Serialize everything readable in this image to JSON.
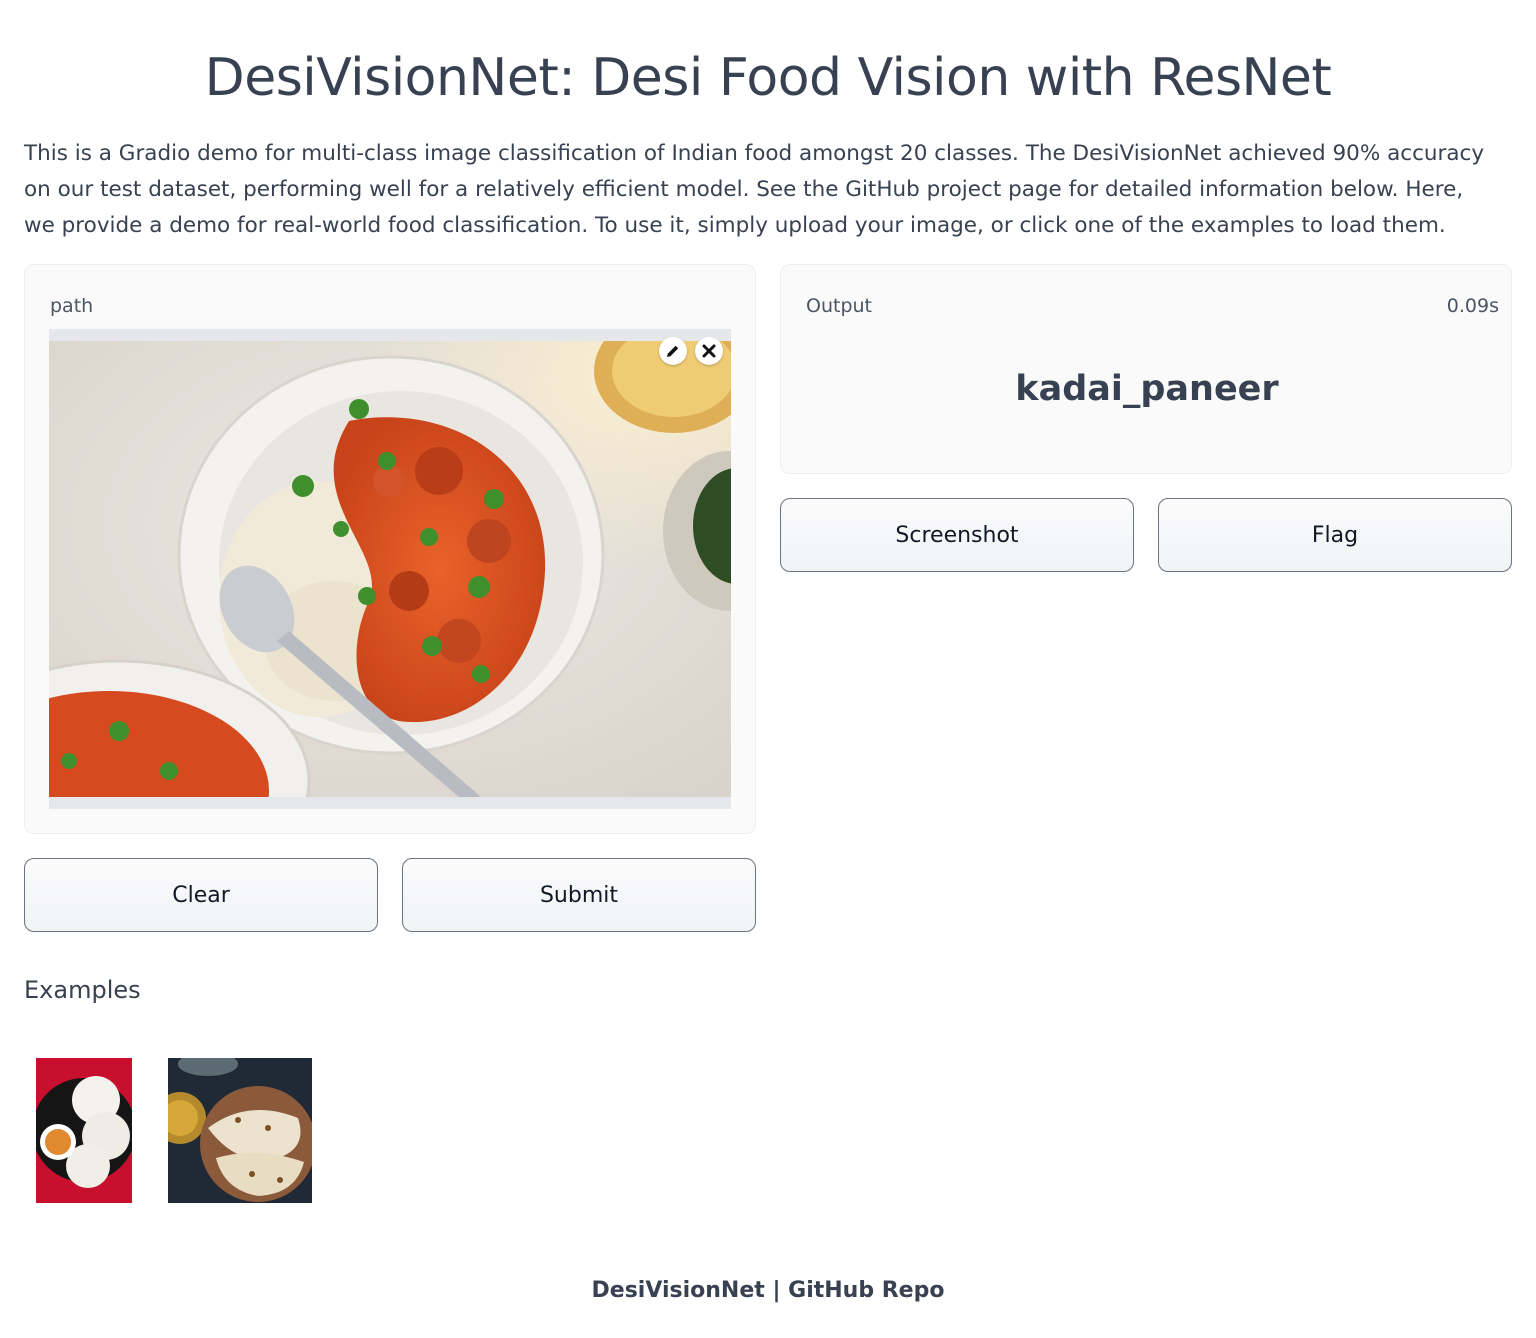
{
  "header": {
    "title": "DesiVisionNet: Desi Food Vision with ResNet",
    "description": "This is a Gradio demo for multi-class image classification of Indian food amongst 20 classes. The DesiVisionNet achieved 90% accuracy on our test dataset, performing well for a relatively efficient model. See the GitHub project page for detailed information below. Here, we provide a demo for real-world food classification. To use it, simply upload your image, or click one of the examples to load them."
  },
  "input": {
    "label": "path",
    "image_icons": [
      "pencil-icon",
      "close-icon"
    ]
  },
  "output": {
    "label": "Output",
    "timing": "0.09s",
    "prediction": "kadai_paneer"
  },
  "buttons": {
    "clear": "Clear",
    "submit": "Submit",
    "screenshot": "Screenshot",
    "flag": "Flag"
  },
  "examples": {
    "heading": "Examples",
    "items": [
      "idli",
      "naan"
    ]
  },
  "footer": {
    "project": "DesiVisionNet",
    "separator": " | ",
    "link": "GitHub Repo"
  }
}
